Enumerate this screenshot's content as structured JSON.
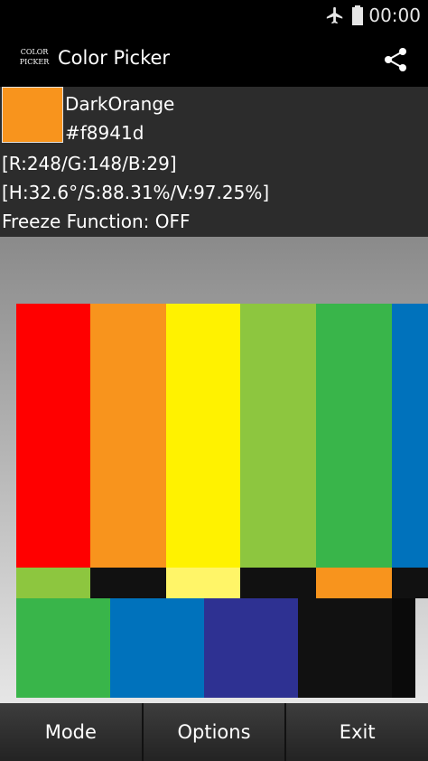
{
  "status_bar": {
    "time": "00:00",
    "icons": [
      "airplane-mode-icon",
      "battery-icon"
    ]
  },
  "app_bar": {
    "logo_line1": "COLOR",
    "logo_line2": "PICKER",
    "title": "Color Picker",
    "share_icon": "share-icon"
  },
  "color_info": {
    "swatch_color": "#f8941d",
    "name": "DarkOrange",
    "hex": "#f8941d",
    "rgb": "[R:248/G:148/B:29]",
    "hsv": "[H:32.6°/S:88.31%/V:97.25%]",
    "freeze": "Freeze Function: OFF"
  },
  "palette": {
    "top_row": [
      "#ff0000",
      "#f8941d",
      "#fff200",
      "#8dc63f",
      "#39b54a",
      "#0072bc"
    ],
    "middle_row": [
      "#8dc63f",
      "#111111",
      "#fff568",
      "#111111",
      "#f8941d",
      "#111111"
    ],
    "bottom_row": [
      "#39b54a",
      "#0072bc",
      "#2e3192",
      "#111111",
      "#0a0a0a"
    ]
  },
  "bottom_bar": {
    "mode": "Mode",
    "options": "Options",
    "exit": "Exit"
  }
}
